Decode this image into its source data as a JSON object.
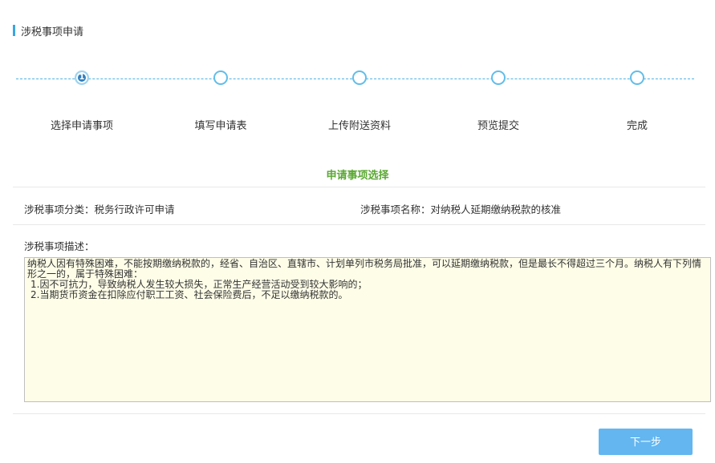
{
  "page": {
    "title": "涉税事项申请"
  },
  "steps": [
    {
      "label": "选择申请事项",
      "number": "1",
      "active": true
    },
    {
      "label": "填写申请表",
      "number": "",
      "active": false
    },
    {
      "label": "上传附送资料",
      "number": "",
      "active": false
    },
    {
      "label": "预览提交",
      "number": "",
      "active": false
    },
    {
      "label": "完成",
      "number": "",
      "active": false
    }
  ],
  "section": {
    "title": "申请事项选择"
  },
  "fields": {
    "category": "涉税事项分类：税务行政许可申请",
    "name": "涉税事项名称：对纳税人延期缴纳税款的核准",
    "description_label": "涉税事项描述："
  },
  "description": {
    "lines": [
      "纳税人因有特殊困难，不能按期缴纳税款的，经省、自治区、直辖市、计划单列市税务局批准，可以延期缴纳税款，但是最长不得超过三个月。纳税人有下列情形之一的，属于特殊困难：",
      "1.因不可抗力，导致纳税人发生较大损失，正常生产经营活动受到较大影响的；",
      "2.当期货币资金在扣除应付职工工资、社会保险费后，不足以缴纳税款的。"
    ]
  },
  "buttons": {
    "next": "下一步"
  },
  "colors": {
    "accent": "#3aa6e0",
    "step_line": "#4fb3e3",
    "section_title": "#5aa832",
    "description_bg": "#fefde8",
    "button_bg": "#63b6f0"
  }
}
